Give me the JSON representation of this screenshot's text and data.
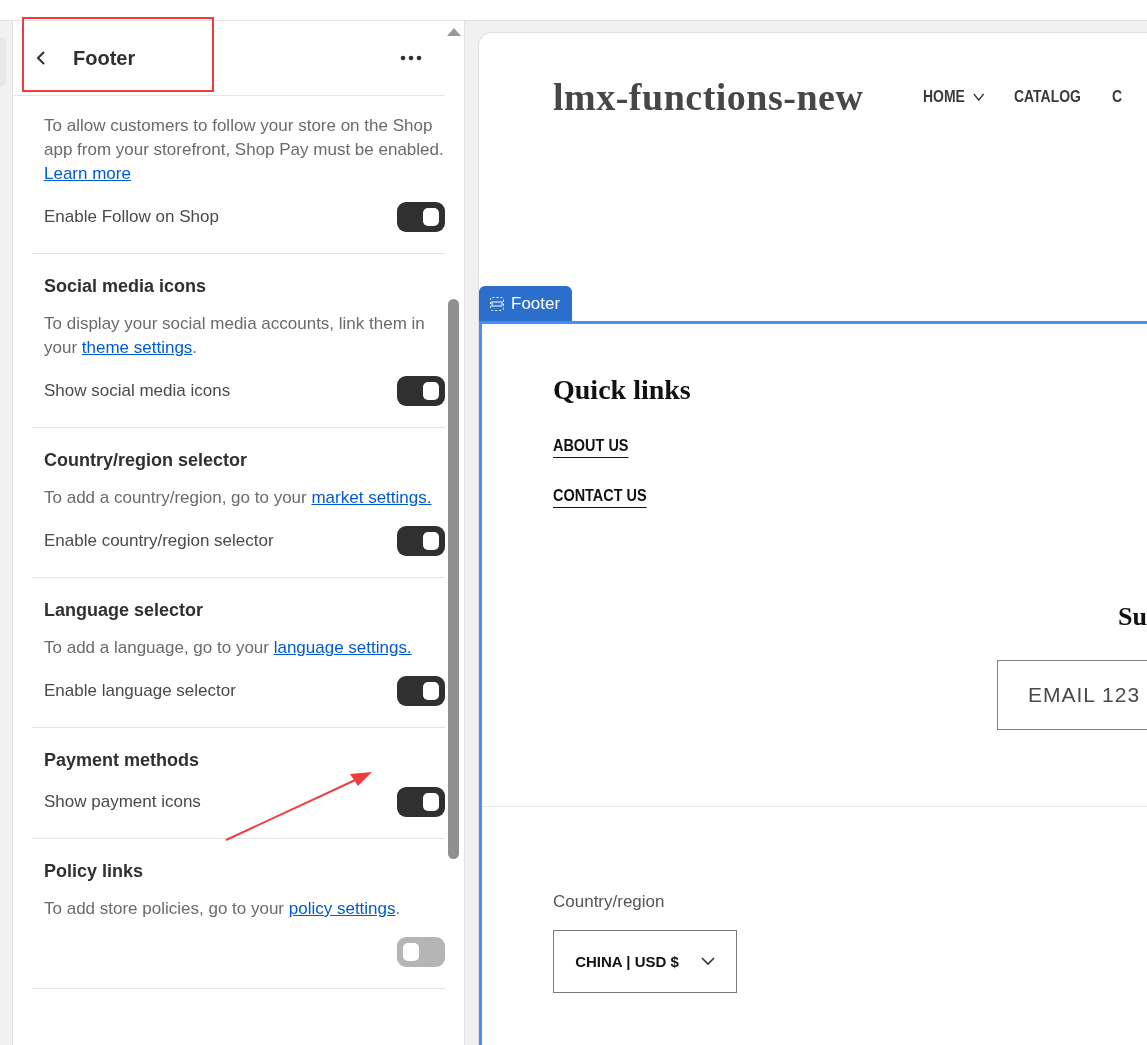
{
  "panel": {
    "title": "Footer",
    "sections": [
      {
        "desc": "To allow customers to follow your store on the Shop app from your storefront, Shop Pay must be enabled. ",
        "link": "Learn more",
        "toggle": {
          "label": "Enable Follow on Shop",
          "on": true
        }
      },
      {
        "title": "Social media icons",
        "desc": "To display your social media accounts, link them in your ",
        "link": "theme settings",
        "after": ".",
        "toggle": {
          "label": "Show social media icons",
          "on": true
        }
      },
      {
        "title": "Country/region selector",
        "desc": "To add a country/region, go to your ",
        "link": "market settings.",
        "toggle": {
          "label": "Enable country/region selector",
          "on": true
        }
      },
      {
        "title": "Language selector",
        "desc": "To add a language, go to your ",
        "link": "language settings.",
        "toggle": {
          "label": "Enable language selector",
          "on": true
        }
      },
      {
        "title": "Payment methods",
        "toggle": {
          "label": "Show payment icons",
          "on": true
        }
      },
      {
        "title": "Policy links",
        "desc": "To add store policies, go to your ",
        "link": "policy settings",
        "after": ".",
        "toggle": {
          "on": false
        }
      }
    ]
  },
  "preview": {
    "logo": "lmx-functions-new",
    "nav": [
      {
        "label": "HOME",
        "dropdown": true
      },
      {
        "label": "CATALOG",
        "dropdown": false
      },
      {
        "label": "C",
        "dropdown": false
      }
    ],
    "section_tag": "Footer",
    "footer": {
      "heading": "Quick links",
      "links": [
        "ABOUT US",
        "CONTACT US"
      ],
      "subscribe_heading": "Su",
      "email_placeholder": "EMAIL 123",
      "country_label": "Country/region",
      "country_value": "CHINA | USD $"
    }
  }
}
